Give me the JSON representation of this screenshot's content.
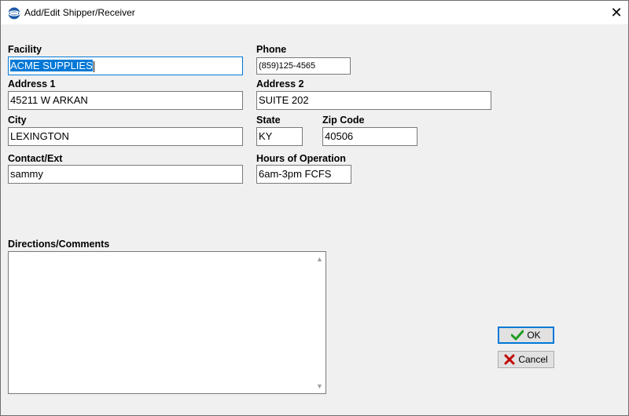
{
  "window": {
    "title": "Add/Edit Shipper/Receiver",
    "close_glyph": "✕",
    "app_icon": "app-logo-icon"
  },
  "labels": {
    "facility": "Facility",
    "phone": "Phone",
    "address1": "Address 1",
    "address2": "Address 2",
    "city": "City",
    "state": "State",
    "zip": "Zip Code",
    "contact": "Contact/Ext",
    "hours": "Hours of Operation",
    "comments": "Directions/Comments"
  },
  "values": {
    "facility": "ACME SUPPLIES",
    "phone": "(859)125-4565",
    "address1": "45211 W ARKAN",
    "address2": "SUITE 202",
    "city": "LEXINGTON",
    "state": "KY",
    "zip": "40506",
    "contact": "sammy",
    "hours": "6am-3pm FCFS",
    "comments": ""
  },
  "buttons": {
    "ok": "OK",
    "cancel": "Cancel"
  },
  "colors": {
    "accent": "#0078d7",
    "ok_check": "#1f9e1f",
    "cancel_x": "#c00000"
  }
}
